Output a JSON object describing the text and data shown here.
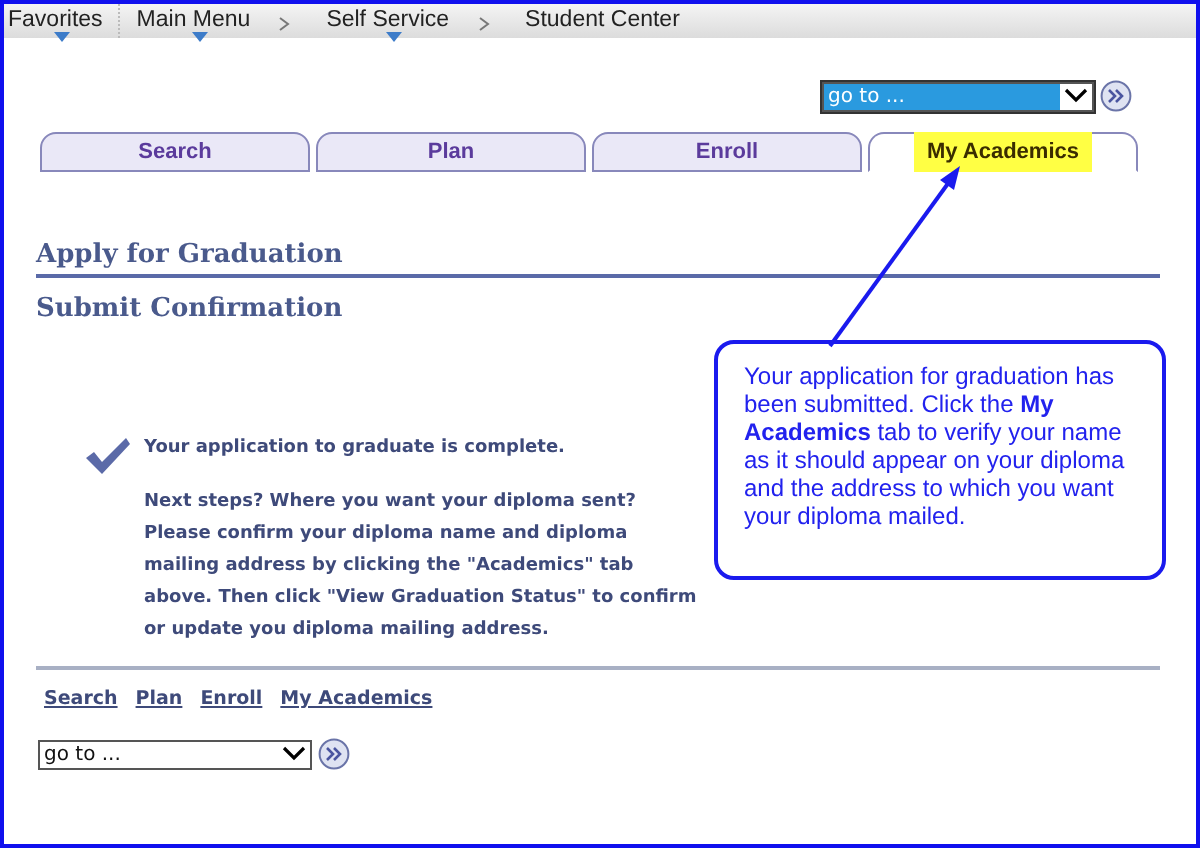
{
  "nav_bar": {
    "items": [
      {
        "label": "Favorites",
        "dropdown": true,
        "separator": false
      },
      {
        "label": "Main Menu",
        "dropdown": true,
        "separator": true
      },
      {
        "label": "Self Service",
        "dropdown": true,
        "separator": true
      },
      {
        "label": "Student Center",
        "dropdown": false,
        "separator": false
      }
    ]
  },
  "top_goto": {
    "value": "go to ...",
    "focused": true
  },
  "tabs": [
    {
      "label": "Search",
      "selected": false,
      "highlighted": false
    },
    {
      "label": "Plan",
      "selected": false,
      "highlighted": false
    },
    {
      "label": "Enroll",
      "selected": false,
      "highlighted": false
    },
    {
      "label": "My Academics",
      "selected": true,
      "highlighted": true
    }
  ],
  "page_title": "Apply for Graduation",
  "subtitle": "Submit Confirmation",
  "confirmation": {
    "message": "Your application to graduate is complete.",
    "next_steps": "Next steps? Where you want your diploma sent? Please confirm your diploma name and diploma mailing address by clicking the \"Academics\" tab above. Then click \"View Graduation Status\" to confirm or update you diploma mailing address."
  },
  "bottom_links": [
    "Search",
    "Plan",
    "Enroll",
    "My Academics"
  ],
  "bottom_goto": {
    "value": "go to ...",
    "focused": false
  },
  "callout": {
    "text": "Your application for graduation has been submitted. Click the **My Academics** tab to verify your name as it should appear on your diploma and the address to which you want your diploma mailed."
  }
}
